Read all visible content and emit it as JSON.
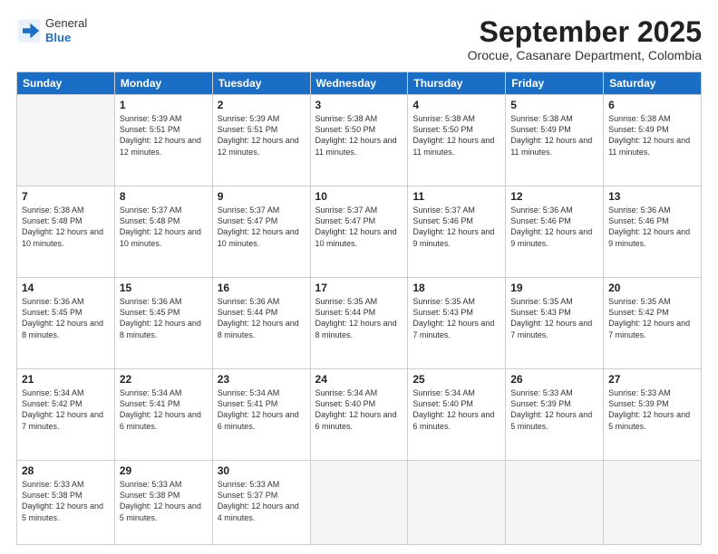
{
  "logo": {
    "general": "General",
    "blue": "Blue"
  },
  "title": "September 2025",
  "subtitle": "Orocue, Casanare Department, Colombia",
  "headers": [
    "Sunday",
    "Monday",
    "Tuesday",
    "Wednesday",
    "Thursday",
    "Friday",
    "Saturday"
  ],
  "weeks": [
    [
      {
        "day": "",
        "info": ""
      },
      {
        "day": "1",
        "info": "Sunrise: 5:39 AM\nSunset: 5:51 PM\nDaylight: 12 hours\nand 12 minutes."
      },
      {
        "day": "2",
        "info": "Sunrise: 5:39 AM\nSunset: 5:51 PM\nDaylight: 12 hours\nand 12 minutes."
      },
      {
        "day": "3",
        "info": "Sunrise: 5:38 AM\nSunset: 5:50 PM\nDaylight: 12 hours\nand 11 minutes."
      },
      {
        "day": "4",
        "info": "Sunrise: 5:38 AM\nSunset: 5:50 PM\nDaylight: 12 hours\nand 11 minutes."
      },
      {
        "day": "5",
        "info": "Sunrise: 5:38 AM\nSunset: 5:49 PM\nDaylight: 12 hours\nand 11 minutes."
      },
      {
        "day": "6",
        "info": "Sunrise: 5:38 AM\nSunset: 5:49 PM\nDaylight: 12 hours\nand 11 minutes."
      }
    ],
    [
      {
        "day": "7",
        "info": "Sunrise: 5:38 AM\nSunset: 5:48 PM\nDaylight: 12 hours\nand 10 minutes."
      },
      {
        "day": "8",
        "info": "Sunrise: 5:37 AM\nSunset: 5:48 PM\nDaylight: 12 hours\nand 10 minutes."
      },
      {
        "day": "9",
        "info": "Sunrise: 5:37 AM\nSunset: 5:47 PM\nDaylight: 12 hours\nand 10 minutes."
      },
      {
        "day": "10",
        "info": "Sunrise: 5:37 AM\nSunset: 5:47 PM\nDaylight: 12 hours\nand 10 minutes."
      },
      {
        "day": "11",
        "info": "Sunrise: 5:37 AM\nSunset: 5:46 PM\nDaylight: 12 hours\nand 9 minutes."
      },
      {
        "day": "12",
        "info": "Sunrise: 5:36 AM\nSunset: 5:46 PM\nDaylight: 12 hours\nand 9 minutes."
      },
      {
        "day": "13",
        "info": "Sunrise: 5:36 AM\nSunset: 5:46 PM\nDaylight: 12 hours\nand 9 minutes."
      }
    ],
    [
      {
        "day": "14",
        "info": "Sunrise: 5:36 AM\nSunset: 5:45 PM\nDaylight: 12 hours\nand 8 minutes."
      },
      {
        "day": "15",
        "info": "Sunrise: 5:36 AM\nSunset: 5:45 PM\nDaylight: 12 hours\nand 8 minutes."
      },
      {
        "day": "16",
        "info": "Sunrise: 5:36 AM\nSunset: 5:44 PM\nDaylight: 12 hours\nand 8 minutes."
      },
      {
        "day": "17",
        "info": "Sunrise: 5:35 AM\nSunset: 5:44 PM\nDaylight: 12 hours\nand 8 minutes."
      },
      {
        "day": "18",
        "info": "Sunrise: 5:35 AM\nSunset: 5:43 PM\nDaylight: 12 hours\nand 7 minutes."
      },
      {
        "day": "19",
        "info": "Sunrise: 5:35 AM\nSunset: 5:43 PM\nDaylight: 12 hours\nand 7 minutes."
      },
      {
        "day": "20",
        "info": "Sunrise: 5:35 AM\nSunset: 5:42 PM\nDaylight: 12 hours\nand 7 minutes."
      }
    ],
    [
      {
        "day": "21",
        "info": "Sunrise: 5:34 AM\nSunset: 5:42 PM\nDaylight: 12 hours\nand 7 minutes."
      },
      {
        "day": "22",
        "info": "Sunrise: 5:34 AM\nSunset: 5:41 PM\nDaylight: 12 hours\nand 6 minutes."
      },
      {
        "day": "23",
        "info": "Sunrise: 5:34 AM\nSunset: 5:41 PM\nDaylight: 12 hours\nand 6 minutes."
      },
      {
        "day": "24",
        "info": "Sunrise: 5:34 AM\nSunset: 5:40 PM\nDaylight: 12 hours\nand 6 minutes."
      },
      {
        "day": "25",
        "info": "Sunrise: 5:34 AM\nSunset: 5:40 PM\nDaylight: 12 hours\nand 6 minutes."
      },
      {
        "day": "26",
        "info": "Sunrise: 5:33 AM\nSunset: 5:39 PM\nDaylight: 12 hours\nand 5 minutes."
      },
      {
        "day": "27",
        "info": "Sunrise: 5:33 AM\nSunset: 5:39 PM\nDaylight: 12 hours\nand 5 minutes."
      }
    ],
    [
      {
        "day": "28",
        "info": "Sunrise: 5:33 AM\nSunset: 5:38 PM\nDaylight: 12 hours\nand 5 minutes."
      },
      {
        "day": "29",
        "info": "Sunrise: 5:33 AM\nSunset: 5:38 PM\nDaylight: 12 hours\nand 5 minutes."
      },
      {
        "day": "30",
        "info": "Sunrise: 5:33 AM\nSunset: 5:37 PM\nDaylight: 12 hours\nand 4 minutes."
      },
      {
        "day": "",
        "info": ""
      },
      {
        "day": "",
        "info": ""
      },
      {
        "day": "",
        "info": ""
      },
      {
        "day": "",
        "info": ""
      }
    ]
  ]
}
